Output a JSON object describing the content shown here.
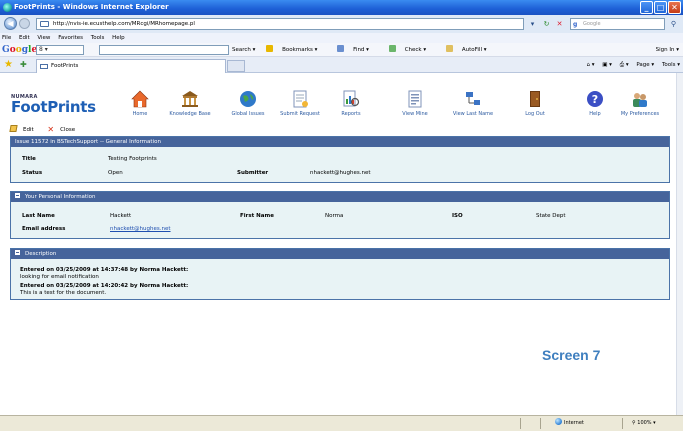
{
  "window": {
    "title": "FootPrints - Windows Internet Explorer"
  },
  "address_bar": {
    "url": "http://nvis-ie.ecusthelp.com/MRcgi/MRhomepage.pl",
    "search_placeholder": "Google"
  },
  "menu": [
    "File",
    "Edit",
    "View",
    "Favorites",
    "Tools",
    "Help"
  ],
  "google_toolbar": {
    "logo": "Google",
    "search_value": "8 ▾",
    "items": [
      "Search ▾",
      "Bookmarks ▾",
      "Find ▾",
      "Check ▾",
      "AutoFill ▾"
    ],
    "sign_in": "Sign In ▾"
  },
  "tab": {
    "title": "FootPrints"
  },
  "command_bar": [
    "Page ▾",
    "Tools ▾"
  ],
  "app": {
    "brand_small": "NUMARA",
    "brand": "FootPrints",
    "nav": [
      {
        "label": "Home",
        "icon": "home-icon"
      },
      {
        "label": "Knowledge Base",
        "icon": "knowledge-base-icon"
      },
      {
        "label": "Global Issues",
        "icon": "globe-icon"
      },
      {
        "label": "Submit Request",
        "icon": "submit-request-icon"
      },
      {
        "label": "Reports",
        "icon": "reports-icon"
      },
      {
        "label": "View Mine",
        "icon": "view-mine-icon"
      },
      {
        "label": "View Last Name",
        "icon": "view-last-name-icon"
      },
      {
        "label": "Log Out",
        "icon": "logout-door-icon"
      },
      {
        "label": "Help",
        "icon": "help-icon"
      },
      {
        "label": "My Preferences",
        "icon": "preferences-icon"
      }
    ],
    "actions": {
      "edit": "Edit",
      "close": "Close"
    }
  },
  "issue": {
    "header": "Issue 11572 in BSTechSupport -- General Information",
    "title_label": "Title",
    "title_value": "Testing Footprints",
    "status_label": "Status",
    "status_value": "Open",
    "submitter_label": "Submitter",
    "submitter_value": "nhackett@hughes.net"
  },
  "personal": {
    "header": "Your Personal Information",
    "last_name_label": "Last Name",
    "last_name_value": "Hackett",
    "first_name_label": "First Name",
    "first_name_value": "Norma",
    "iso_label": "ISO",
    "iso_value": "State Dept",
    "email_label": "Email address",
    "email_value": "nhackett@hughes.net"
  },
  "description": {
    "header": "Description",
    "entries": [
      {
        "heading": "Entered on 03/25/2009 at 14:37:48 by Norma Hackett:",
        "text": "looking for email notification"
      },
      {
        "heading": "Entered on 03/25/2009 at 14:20:42 by Norma Hackett:",
        "text": "This is a test for the document."
      }
    ]
  },
  "caption": "Screen 7",
  "status_bar": {
    "zone": "Internet",
    "zoom": "100%"
  }
}
